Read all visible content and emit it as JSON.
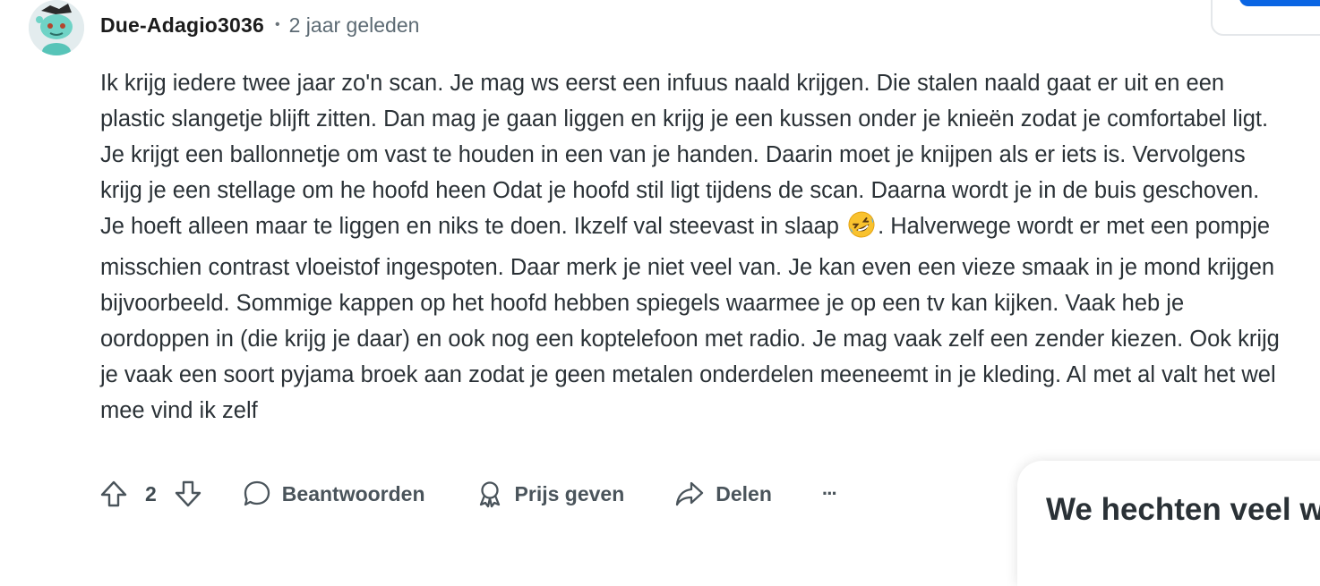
{
  "comment": {
    "author": "Due-Adagio3036",
    "separator": "•",
    "timestamp": "2 jaar geleden",
    "avatar_icon": "snoo-avatar-icon",
    "body_part1": "Ik krijg iedere twee jaar zo'n scan. Je mag ws eerst een infuus naald krijgen. Die stalen naald gaat er uit en een plastic slangetje blijft zitten. Dan mag je gaan liggen en krijg je een kussen onder je knieën zodat je comfortabel ligt. Je krijgt een ballonnetje om vast te houden in een van je handen. Daarin moet je knijpen als er iets is. Vervolgens krijg je een stellage om he hoofd heen Odat je hoofd stil ligt tijdens de scan. Daarna wordt je in de buis geschoven. Je hoeft alleen maar te liggen en niks te doen. Ikzelf val steevast in slaap",
    "body_emoji": "rolling-on-floor-laughing-emoji",
    "body_part2": ". Halverwege wordt er met een pompje misschien contrast vloeistof ingespoten. Daar merk je niet veel van. Je kan even een vieze smaak in je mond krijgen bijvoorbeeld. Sommige kappen op het hoofd hebben spiegels waarmee je op een tv kan kijken. Vaak heb je oordoppen in (die krijg je daar) en ook nog een koptelefoon met radio. Je mag vaak zelf een zender kiezen. Ook krijg je vaak een soort pyjama broek aan zodat je geen metalen onderdelen meeneemt in je kleding. Al met al valt het wel mee vind ik zelf"
  },
  "actions": {
    "vote_count": "2",
    "reply_label": "Beantwoorden",
    "award_label": "Prijs geven",
    "share_label": "Delen",
    "more_label": "···"
  },
  "popup": {
    "title": "We hechten veel w"
  },
  "colors": {
    "primary_blue": "#0a65e3",
    "text": "#2a3136",
    "muted": "#5c6a73"
  }
}
